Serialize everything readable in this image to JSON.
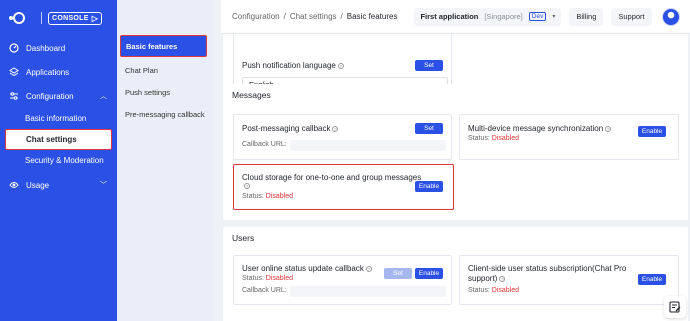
{
  "nav": {
    "logo_badge": "CONSOLE",
    "items": [
      {
        "label": "Dashboard",
        "icon": "dashboard-icon"
      },
      {
        "label": "Applications",
        "icon": "layers-icon"
      },
      {
        "label": "Configuration",
        "icon": "sliders-icon"
      },
      {
        "label": "Usage",
        "icon": "eye-icon"
      }
    ],
    "config_sub": [
      {
        "label": "Basic information"
      },
      {
        "label": "Chat settings"
      },
      {
        "label": "Security & Moderation"
      }
    ]
  },
  "subnav": {
    "items": [
      {
        "label": "Basic features"
      },
      {
        "label": "Chat Plan"
      },
      {
        "label": "Push settings"
      },
      {
        "label": "Pre-messaging callback"
      }
    ]
  },
  "header": {
    "breadcrumb": [
      "Configuration",
      "Chat settings",
      "Basic features"
    ],
    "app_name": "First application",
    "app_region": "[Singapore]",
    "env_tag": "Dev",
    "billing": "Billing",
    "support": "Support"
  },
  "push_lang": {
    "title": "Push notification language",
    "set": "Set",
    "value": "English"
  },
  "messages": {
    "title": "Messages",
    "post_callback": {
      "title": "Post-messaging callback",
      "set": "Set",
      "url_label": "Callback URL:"
    },
    "multi_device": {
      "title": "Multi-device message synchronization",
      "status_label": "Status:",
      "status": "Disabled",
      "enable": "Enable"
    },
    "cloud_storage": {
      "title": "Cloud storage for one-to-one and group messages",
      "status_label": "Status:",
      "status": "Disabled",
      "enable": "Enable"
    }
  },
  "users": {
    "title": "Users",
    "online_callback": {
      "title": "User online status update callback",
      "status_label": "Status:",
      "status": "Disabled",
      "set": "Set",
      "enable": "Enable",
      "url_label": "Callback URL:"
    },
    "client_sub": {
      "title_line1": "Client-side user status subscription(Chat Pro",
      "title_line2": "support)",
      "status_label": "Status:",
      "status": "Disabled",
      "enable": "Enable"
    }
  },
  "colors": {
    "brand": "#2b50e6",
    "danger": "#e0363b"
  }
}
